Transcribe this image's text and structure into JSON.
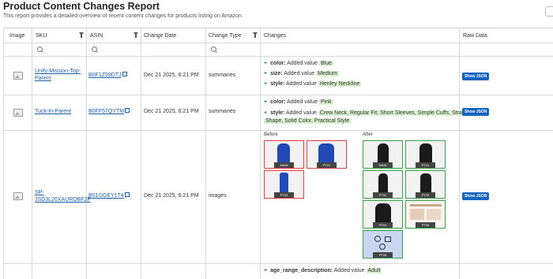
{
  "header": {
    "title": "Product Content Changes Report",
    "subtitle": "This report provides a detailed overview of recent content changes for products listing on Amazon."
  },
  "columns": {
    "image": "Image",
    "sku": "SKU",
    "asin": "ASIN",
    "change_date": "Change Date",
    "change_type": "Change Type",
    "changes": "Changes",
    "raw_data": "Raw Data"
  },
  "labels": {
    "added_value": "Added value",
    "before": "Before",
    "after": "After",
    "show_json": "Show JSON"
  },
  "rows": [
    {
      "sku": "Unify-Mission-Top-Parent",
      "asin": "B0F1Z59DTJ",
      "date": "Dec 21 2025, 6:21 PM",
      "type": "summaries",
      "changes": [
        {
          "key": "color:",
          "value": "Blue"
        },
        {
          "key": "size:",
          "value": "Medium"
        },
        {
          "key": "style:",
          "value": "Henley Neckline"
        }
      ]
    },
    {
      "sku": "Tuck-In-Parent",
      "asin": "B0FF57QYTM",
      "date": "Dec 21 2025, 6:21 PM",
      "type": "summaries",
      "changes": [
        {
          "key": "color:",
          "value": "Pink"
        },
        {
          "key": "style:",
          "value": "Crew Neck, Regular Fit, Short Sleeves, Simple Cuffs, Straight",
          "value2": "Shape, Solid Color, Practical Style"
        }
      ]
    },
    {
      "sku": "SP-JSD3L20XAUROBF2F",
      "asin": "B01GGEY1T4",
      "date": "Dec 21 2025, 6:21 PM",
      "type": "images",
      "before": [
        "MAIN",
        "PT01",
        "PT02"
      ],
      "after": [
        "MAIN",
        "PT01",
        "PT02",
        "PT03",
        "PT04",
        "PT05",
        "PT06"
      ]
    },
    {
      "changes": [
        {
          "key": "age_range_description:",
          "value": "Adult"
        }
      ]
    }
  ],
  "colors": {
    "link": "#1a5ea8",
    "added_bg": "#d9f2cf",
    "plus": "#2e8b57",
    "button": "#1565c0",
    "before_border": "#d9453d",
    "after_border": "#3aa04a"
  }
}
